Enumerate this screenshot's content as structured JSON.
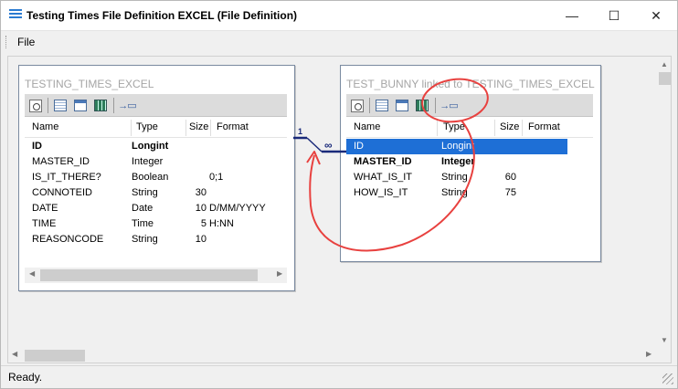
{
  "window": {
    "title": "Testing Times File Definition EXCEL (File Definition)",
    "minimize_glyph": "—",
    "maximize_glyph": "☐",
    "close_glyph": "✕",
    "icon": "list-icon"
  },
  "menu": {
    "file": "File"
  },
  "columns": {
    "name": "Name",
    "type": "Type",
    "size": "Size",
    "format": "Format"
  },
  "left_table": {
    "title": "TESTING_TIMES_EXCEL",
    "rows": [
      {
        "name": "ID",
        "type": "Longint",
        "size": "",
        "format": "",
        "bold": true
      },
      {
        "name": "MASTER_ID",
        "type": "Integer",
        "size": "",
        "format": ""
      },
      {
        "name": "IS_IT_THERE?",
        "type": "Boolean",
        "size": "",
        "format": "0;1"
      },
      {
        "name": "CONNOTEID",
        "type": "String",
        "size": "30",
        "format": ""
      },
      {
        "name": "DATE",
        "type": "Date",
        "size": "10",
        "format": "D/MM/YYYY"
      },
      {
        "name": "TIME",
        "type": "Time",
        "size": "5",
        "format": "H:NN"
      },
      {
        "name": "REASONCODE",
        "type": "String",
        "size": "10",
        "format": ""
      }
    ]
  },
  "right_table": {
    "title": "TEST_BUNNY linked to TESTING_TIMES_EXCEL",
    "rows": [
      {
        "name": "ID",
        "type": "Longint",
        "size": "",
        "format": "",
        "selected": true
      },
      {
        "name": "MASTER_ID",
        "type": "Integer",
        "size": "",
        "format": "",
        "bold": true
      },
      {
        "name": "WHAT_IS_IT",
        "type": "String",
        "size": "60",
        "format": ""
      },
      {
        "name": "HOW_IS_IT",
        "type": "String",
        "size": "75",
        "format": ""
      }
    ]
  },
  "relation": {
    "one": "1",
    "many": "∞"
  },
  "status": {
    "text": "Ready."
  },
  "colors": {
    "selection": "#1e6fd6",
    "annotation": "#e8413f",
    "relation_line": "#1a2a7a"
  }
}
